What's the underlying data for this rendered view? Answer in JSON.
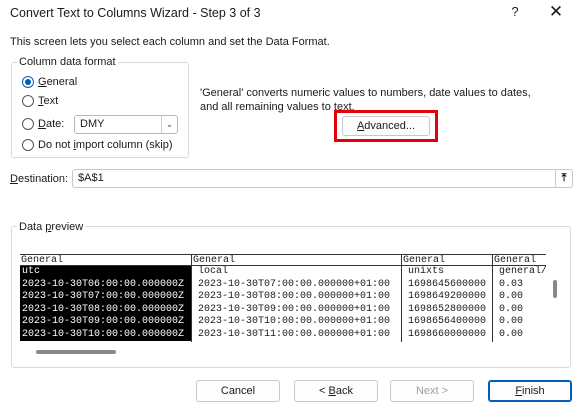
{
  "window": {
    "title": "Convert Text to Columns Wizard - Step 3 of 3",
    "help_glyph": "?",
    "close_glyph": "✕"
  },
  "description": "This screen lets you select each column and set the Data Format.",
  "column_format": {
    "legend": "Column data format",
    "options": {
      "general": {
        "pre": "",
        "ul": "G",
        "post": "eneral",
        "selected": true
      },
      "text": {
        "pre": "",
        "ul": "T",
        "post": "ext",
        "selected": false
      },
      "date": {
        "pre": "",
        "ul": "D",
        "post": "ate:",
        "selected": false
      },
      "skip": {
        "pre": "Do not ",
        "ul": "i",
        "post": "mport column (skip)",
        "selected": false
      }
    },
    "date_value": "DMY"
  },
  "info_text": "'General' converts numeric values to numbers, date values to dates, and all remaining values to text.",
  "advanced": {
    "ul": "A",
    "post": "dvanced...",
    "highlight_color": "#e3000b"
  },
  "destination": {
    "pre": "",
    "ul": "D",
    "post": "estination:",
    "value": "$A$1"
  },
  "preview": {
    "legend_pre": "Data ",
    "legend_ul": "p",
    "legend_post": "review",
    "columns": [
      {
        "header": "General",
        "selected": true,
        "cells": [
          "utc",
          "2023-10-30T06:00:00.000000Z",
          "2023-10-30T07:00:00.000000Z",
          "2023-10-30T08:00:00.000000Z",
          "2023-10-30T09:00:00.000000Z",
          "2023-10-30T10:00:00.000000Z"
        ]
      },
      {
        "header": "General",
        "selected": false,
        "cells": [
          "local",
          "2023-10-30T07:00:00.000000+01:00",
          "2023-10-30T08:00:00.000000+01:00",
          "2023-10-30T09:00:00.000000+01:00",
          "2023-10-30T10:00:00.000000+01:00",
          "2023-10-30T11:00:00.000000+01:00"
        ]
      },
      {
        "header": "General",
        "selected": false,
        "cells": [
          "unixts",
          "1698645600000",
          "1698649200000",
          "1698652800000",
          "1698656400000",
          "1698660000000"
        ]
      },
      {
        "header": "General",
        "selected": false,
        "cells": [
          "general/",
          "0.03",
          "0.00",
          "0.00",
          "0.00",
          "0.00"
        ]
      }
    ]
  },
  "buttons": {
    "cancel": "Cancel",
    "back": {
      "pre": "< ",
      "ul": "B",
      "post": "ack"
    },
    "next": "Next >",
    "finish": {
      "pre": "",
      "ul": "F",
      "post": "inish"
    }
  },
  "colors": {
    "accent": "#005fb8",
    "highlight": "#e3000b"
  }
}
